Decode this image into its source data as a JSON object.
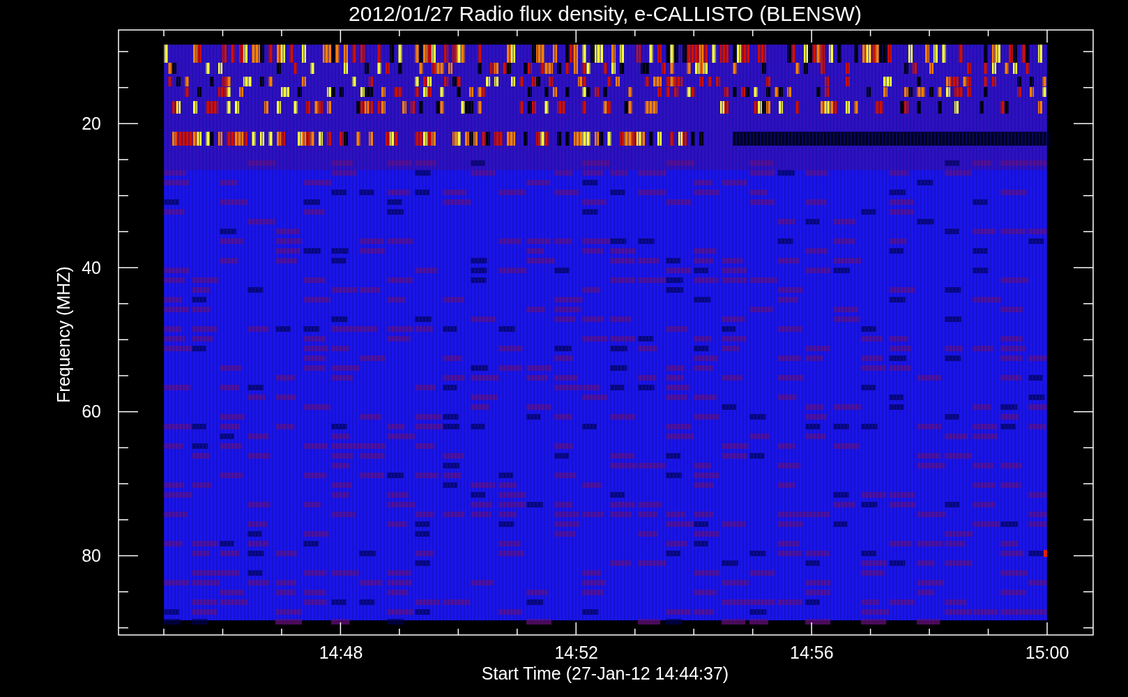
{
  "title": "2012/01/27  Radio flux density, e-CALLISTO (BLENSW)",
  "x_axis": {
    "label": "Start Time (27-Jan-12 14:44:37)",
    "ticks": [
      "14:48",
      "14:52",
      "14:56",
      "15:00"
    ]
  },
  "y_axis": {
    "label": "Frequency (MHZ)",
    "ticks": [
      "20",
      "40",
      "60",
      "80"
    ]
  }
}
